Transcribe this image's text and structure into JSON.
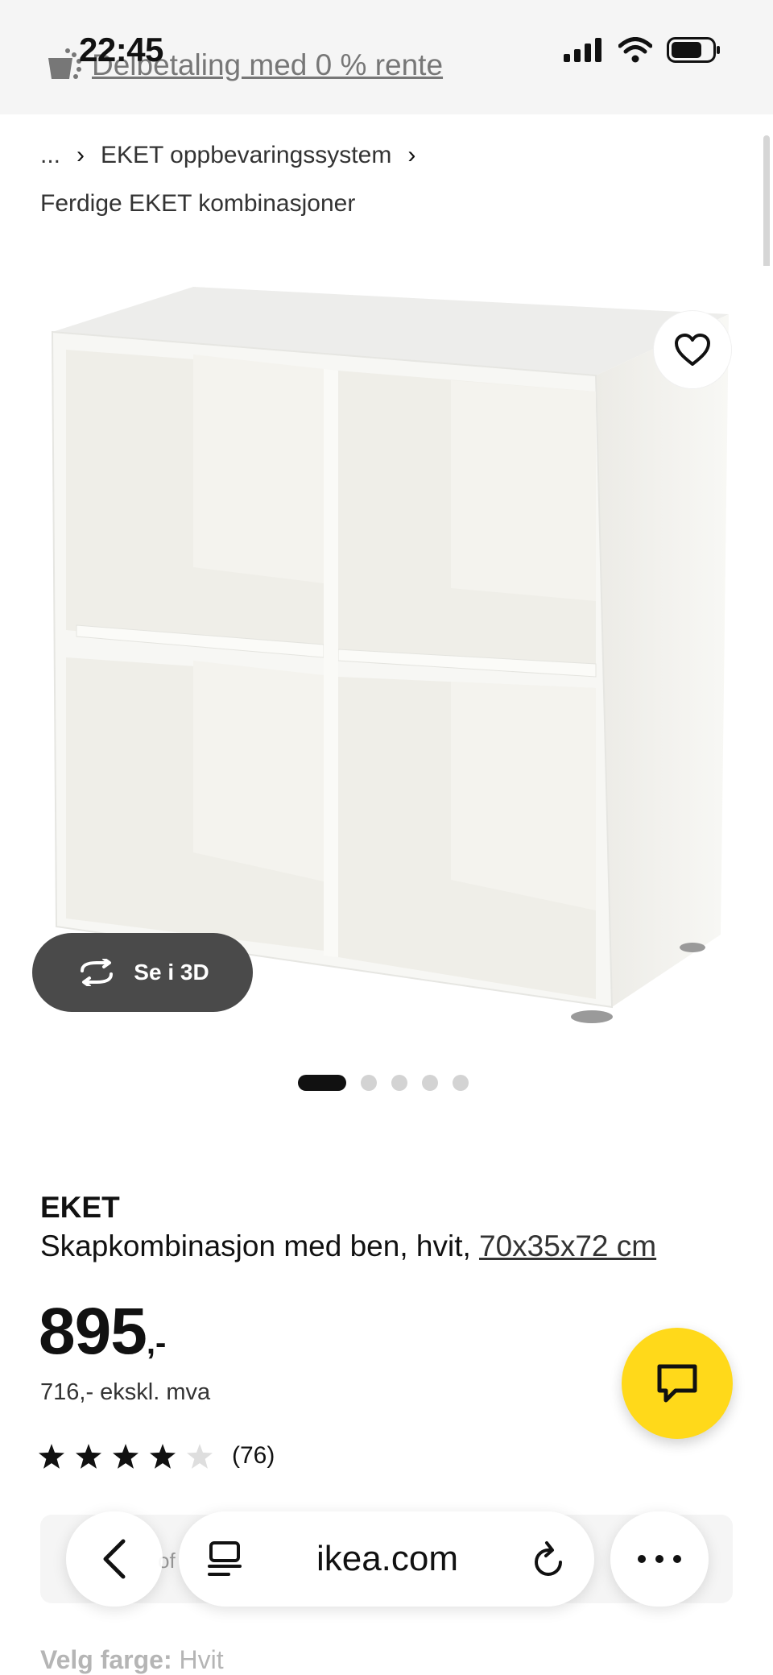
{
  "status_bar": {
    "time": "22:45"
  },
  "promo": {
    "text": "Delbetaling med 0 % rente"
  },
  "breadcrumb": {
    "ellipsis": "...",
    "item": "EKET oppbevaringssystem",
    "current": "Ferdige EKET kombinasjoner"
  },
  "product": {
    "image_alt": "EKET skapkombinasjon med ben, hvit",
    "view_3d_label": "Se i 3D",
    "brand": "EKET",
    "description": "Skapkombinasjon med ben, hvit, ",
    "dimensions": "70x35x72 cm",
    "price_number": "895",
    "price_suffix": ",-",
    "price_ex_vat": "716,- ekskl. mva",
    "rating": 4,
    "rating_max": 5,
    "review_count": "(76)"
  },
  "carousel": {
    "total": 5,
    "active": 1
  },
  "panel": {
    "partial_text": "of"
  },
  "browser": {
    "url": "ikea.com"
  },
  "color_picker": {
    "label": "Velg farge:",
    "value": "Hvit"
  },
  "colors": {
    "accent": "#ffd91a",
    "dark_button": "#4a4a4a"
  }
}
